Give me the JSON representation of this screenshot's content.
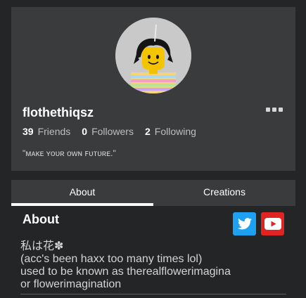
{
  "profile": {
    "username": "flothethiqsz",
    "status": "\"ᴍᴀᴋᴇ ʏᴏᴜʀ ᴏᴡɴ ꜰᴜᴛᴜʀᴇ.\"",
    "stats": [
      {
        "count": "39",
        "label": "Friends"
      },
      {
        "count": "0",
        "label": "Followers"
      },
      {
        "count": "2",
        "label": "Following"
      }
    ]
  },
  "tabs": [
    {
      "label": "About",
      "active": true
    },
    {
      "label": "Creations",
      "active": false
    }
  ],
  "about": {
    "title": "About",
    "lines": [
      "私は花✽",
      "(acc's been haxx too many times lol)",
      "used to be known as therealflowerimagina",
      "or flowerimagination"
    ]
  },
  "social": {
    "twitter_icon": "twitter-icon",
    "youtube_icon": "youtube-icon",
    "twitter_color": "#1da1f2",
    "youtube_color": "#e02424"
  }
}
